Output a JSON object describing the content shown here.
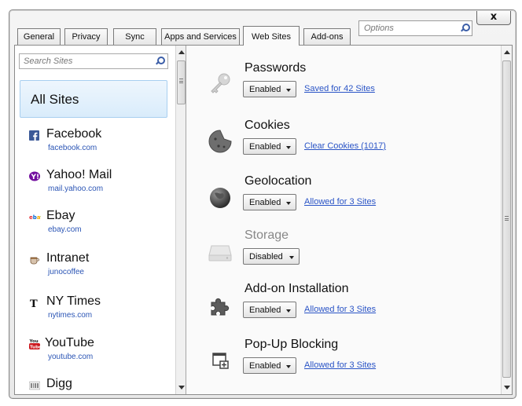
{
  "window": {
    "close_label": "x",
    "options_placeholder": "Options"
  },
  "tabs": [
    {
      "label": "General"
    },
    {
      "label": "Privacy"
    },
    {
      "label": "Sync"
    },
    {
      "label": "Apps and Services"
    },
    {
      "label": "Web Sites",
      "active": true
    },
    {
      "label": "Add-ons"
    }
  ],
  "sidebar": {
    "search_placeholder": "Search Sites",
    "all_sites_label": "All Sites",
    "sites": [
      {
        "name": "Facebook",
        "url": "facebook.com",
        "icon": "facebook-icon"
      },
      {
        "name": "Yahoo! Mail",
        "url": "mail.yahoo.com",
        "icon": "yahoo-icon"
      },
      {
        "name": "Ebay",
        "url": "ebay.com",
        "icon": "ebay-icon"
      },
      {
        "name": "Intranet",
        "url": "junocoffee",
        "icon": "coffee-cup-icon"
      },
      {
        "name": "NY Times",
        "url": "nytimes.com",
        "icon": "nytimes-icon"
      },
      {
        "name": "YouTube",
        "url": "youtube.com",
        "icon": "youtube-icon"
      },
      {
        "name": "Digg",
        "url": "",
        "icon": "digg-icon"
      }
    ]
  },
  "permissions": [
    {
      "title": "Passwords",
      "value": "Enabled",
      "link": "Saved for 42 Sites",
      "icon": "key-icon"
    },
    {
      "title": "Cookies",
      "value": "Enabled",
      "link": "Clear Cookies (1017)",
      "icon": "cookie-icon"
    },
    {
      "title": "Geolocation",
      "value": "Enabled",
      "link": "Allowed for 3 Sites",
      "icon": "globe-icon"
    },
    {
      "title": "Storage",
      "value": "Disabled",
      "link": "",
      "icon": "hard-drive-icon",
      "muted": true
    },
    {
      "title": "Add-on Installation",
      "value": "Enabled",
      "link": "Allowed for 3 Sites",
      "icon": "puzzle-piece-icon"
    },
    {
      "title": "Pop-Up Blocking",
      "value": "Enabled",
      "link": "Allowed for 3 Sites",
      "icon": "popup-window-icon"
    }
  ],
  "colors": {
    "link": "#2a54c6",
    "selection": "#d9ecfb",
    "facebook": "#3b5998",
    "yahoo": "#720e9e",
    "youtube": "#cc181e"
  }
}
